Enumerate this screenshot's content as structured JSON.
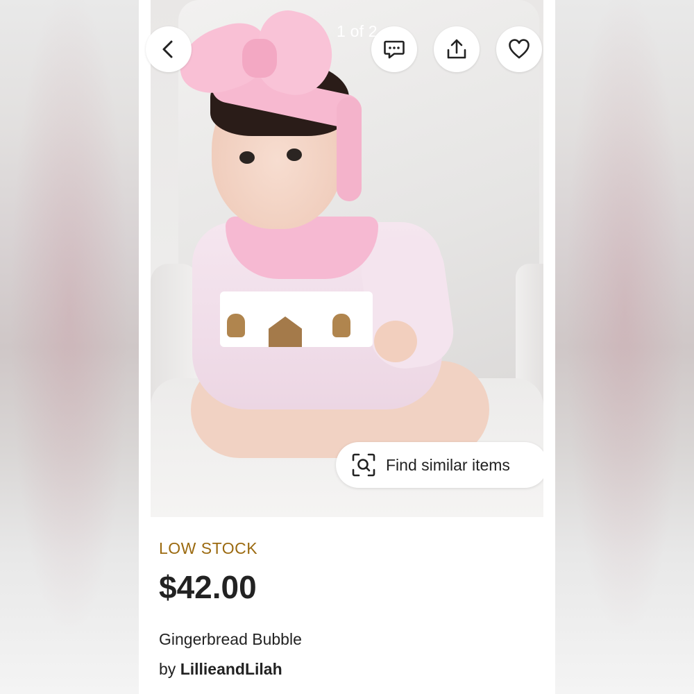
{
  "gallery": {
    "pager_text": "1 of 2",
    "find_similar_label": "Find similar items",
    "image_icon": "product-photo"
  },
  "toolbar": {
    "back_icon": "chevron-left-icon",
    "message_icon": "message-icon",
    "share_icon": "share-icon",
    "favorite_icon": "heart-icon"
  },
  "product": {
    "stock_label": "LOW STOCK",
    "price": "$42.00",
    "title": "Gingerbread Bubble",
    "by_label": "by",
    "shop_name": "LillieandLilah"
  },
  "colors": {
    "stock": "#9b6a10",
    "text": "#222222",
    "background": "#ffffff"
  }
}
